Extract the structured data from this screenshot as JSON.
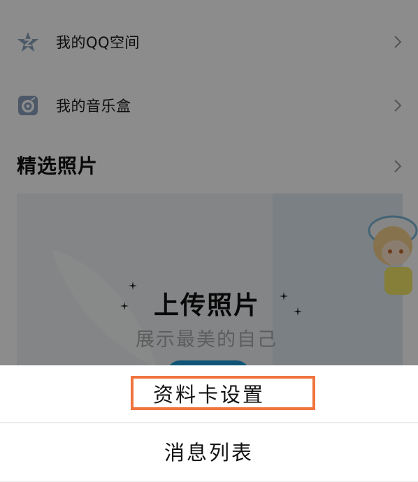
{
  "list_items": [
    {
      "label": "我的QQ空间",
      "icon": "qzone-star-icon"
    },
    {
      "label": "我的音乐盒",
      "icon": "music-box-icon"
    }
  ],
  "featured_photos": {
    "title": "精选照片",
    "upload_title": "上传照片",
    "upload_subtitle": "展示最美的自己"
  },
  "action_sheet": {
    "options": [
      "资料卡设置",
      "消息列表"
    ],
    "highlighted_option": "资料卡设置",
    "highlight_color": "#f0743e"
  },
  "colors": {
    "overlay": "rgba(0,0,0,0.45)",
    "accent": "#1e9bd7"
  }
}
